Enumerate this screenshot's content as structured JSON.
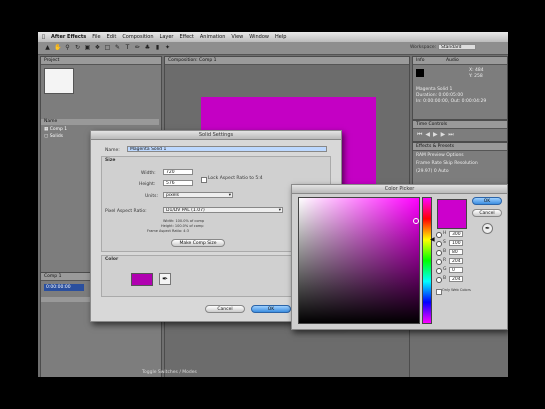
{
  "menubar": {
    "apple": "",
    "app": "After Effects",
    "items": [
      "File",
      "Edit",
      "Composition",
      "Layer",
      "Effect",
      "Animation",
      "View",
      "Window",
      "Help"
    ]
  },
  "workspace": {
    "label": "Workspace:",
    "value": "Standard"
  },
  "project_panel": {
    "tab": "Project",
    "items": [
      "Comp 1",
      "Solids"
    ]
  },
  "composition_panel": {
    "tab": "Composition: Comp 1"
  },
  "info_panel": {
    "tabs": [
      "Info",
      "Audio"
    ],
    "readout": [
      "X: 484",
      "Y: 258"
    ],
    "lines": [
      "Magenta Solid 1",
      "Duration: 0:00:05:00",
      "In: 0:00:00:00, Out: 0:00:04:29"
    ]
  },
  "time_controls": {
    "tab": "Time Controls"
  },
  "effects_panel": {
    "tab": "Effects & Presets",
    "rows": [
      "RAM Preview Options",
      "Frame Rate   Skip   Resolution",
      "(29.97)   0   Auto"
    ]
  },
  "timeline": {
    "tab": "Comp 1",
    "timecode": "0:00:00:00",
    "footer": "Toggle Switches / Modes"
  },
  "solid_settings": {
    "title": "Solid Settings",
    "name_label": "Name:",
    "name_value": "Magenta Solid 1",
    "size_label": "Size",
    "width_label": "Width:",
    "width_value": "720",
    "height_label": "Height:",
    "height_value": "576",
    "lock_label": "Lock Aspect Ratio to 5:4",
    "units_label": "Units:",
    "units_value": "pixels",
    "par_label": "Pixel Aspect Ratio:",
    "par_value": "D1/DV PAL (1.07)",
    "info_lines": [
      "Width: 100.0% of comp",
      "Height: 100.0% of comp",
      "Frame Aspect Ratio: 4:3"
    ],
    "make_comp_size": "Make Comp Size",
    "color_label": "Color",
    "swatch_color": "#b000b0",
    "cancel": "Cancel",
    "ok": "OK"
  },
  "color_picker": {
    "title": "Color Picker",
    "current_color": "#cc00cc",
    "hue_color": "#ff00ff",
    "fields": [
      {
        "label": "H",
        "value": "300"
      },
      {
        "label": "S",
        "value": "100"
      },
      {
        "label": "B",
        "value": "80"
      },
      {
        "label": "R",
        "value": "204"
      },
      {
        "label": "G",
        "value": "0"
      },
      {
        "label": "B",
        "value": "204"
      }
    ],
    "only_web": "Only Web Colors",
    "ok": "OK",
    "cancel": "Cancel"
  },
  "comp_color": "#c400c4"
}
